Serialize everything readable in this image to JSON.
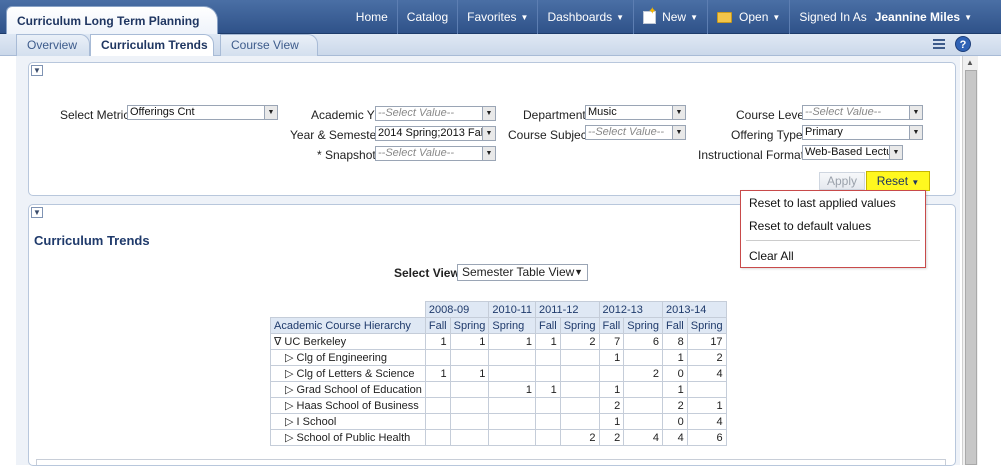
{
  "app": {
    "title": "Curriculum Long Term Planning"
  },
  "topnav": {
    "home": "Home",
    "catalog": "Catalog",
    "favorites": "Favorites",
    "dashboards": "Dashboards",
    "new": "New",
    "open": "Open",
    "signed_in_as": "Signed In As",
    "user": "Jeannine Miles"
  },
  "tabs": [
    "Overview",
    "Curriculum Trends",
    "Course View"
  ],
  "prompts": {
    "select_metric": {
      "label": "Select Metric",
      "value": "Offerings Cnt"
    },
    "academic_yr": {
      "label": "Academic Yr",
      "placeholder": "--Select Value--"
    },
    "year_semester": {
      "label": "Year & Semester",
      "value": "2014 Spring;2013 Fal"
    },
    "snapshot": {
      "label": "* Snapshot",
      "placeholder": "--Select Value--"
    },
    "department": {
      "label": "Department",
      "value": "Music"
    },
    "course_subject": {
      "label": "Course Subject",
      "placeholder": "--Select Value--"
    },
    "course_level": {
      "label": "Course Level",
      "placeholder": "--Select Value--"
    },
    "offering_type": {
      "label": "Offering Type",
      "value": "Primary"
    },
    "instructional_format": {
      "label": "Instructional Format",
      "value": "Web-Based Lectu"
    },
    "apply": "Apply",
    "reset": "Reset"
  },
  "reset_menu": [
    "Reset to last applied values",
    "Reset to default values",
    "Clear All"
  ],
  "results": {
    "title": "Curriculum Trends",
    "select_view_label": "Select View",
    "select_view_value": "Semester Table View"
  },
  "table": {
    "years": [
      "2008-09",
      "2010-11",
      "2011-12",
      "2012-13",
      "2013-14"
    ],
    "hierarchy_header": "Academic Course Hierarchy",
    "subheaders": [
      "Fall",
      "Spring",
      "Spring",
      "Fall",
      "Spring",
      "Fall",
      "Spring",
      "Fall",
      "Spring"
    ],
    "rows": [
      {
        "label": "∇ UC Berkeley",
        "values": [
          "1",
          "1",
          "1",
          "1",
          "2",
          "7",
          "6",
          "8",
          "17"
        ]
      },
      {
        "label": "▷ Clg of Engineering",
        "values": [
          "",
          "",
          "",
          "",
          "",
          "1",
          "",
          "1",
          "2"
        ]
      },
      {
        "label": "▷ Clg of Letters & Science",
        "values": [
          "1",
          "1",
          "",
          "",
          "",
          "",
          "2",
          "0",
          "4"
        ]
      },
      {
        "label": "▷ Grad School of Education",
        "values": [
          "",
          "",
          "1",
          "1",
          "",
          "1",
          "",
          "1",
          ""
        ]
      },
      {
        "label": "▷ Haas School of Business",
        "values": [
          "",
          "",
          "",
          "",
          "",
          "2",
          "",
          "2",
          "1"
        ]
      },
      {
        "label": "▷ I School",
        "values": [
          "",
          "",
          "",
          "",
          "",
          "1",
          "",
          "0",
          "4"
        ]
      },
      {
        "label": "▷ School of Public Health",
        "values": [
          "",
          "",
          "",
          "",
          "2",
          "2",
          "4",
          "4",
          "6"
        ]
      }
    ]
  }
}
